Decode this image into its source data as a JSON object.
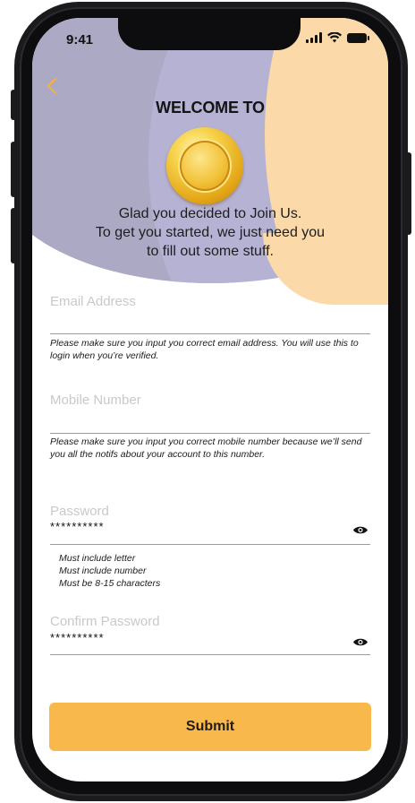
{
  "status_bar": {
    "time": "9:41"
  },
  "header": {
    "back_icon": "chevron-left-icon",
    "title": "WELCOME TO",
    "logo_icon": "gold-coin-logo",
    "subtitle_lines": [
      "Glad you decided to Join Us.",
      "To get you started, we just need you",
      "to fill out some stuff."
    ]
  },
  "form": {
    "email": {
      "placeholder": "Email Address",
      "help": "Please make sure you input you correct email  address. You will use this to login when you’re verified."
    },
    "mobile": {
      "placeholder": "Mobile Number",
      "help": "Please make sure you input you correct mobile number because we’ll send you all the notifs about your account to this number."
    },
    "password": {
      "label": "Password",
      "value": "**********",
      "toggle_icon": "eye-icon",
      "rules": [
        "Must include letter",
        "Must include number",
        "Must be 8-15 characters"
      ]
    },
    "confirm_password": {
      "label": "Confirm Password",
      "value": "**********",
      "toggle_icon": "eye-icon"
    },
    "submit_label": "Submit"
  },
  "colors": {
    "accent": "#f9b84c",
    "header_lavender": "#aca9c5",
    "header_peach": "#fbd9a9"
  }
}
